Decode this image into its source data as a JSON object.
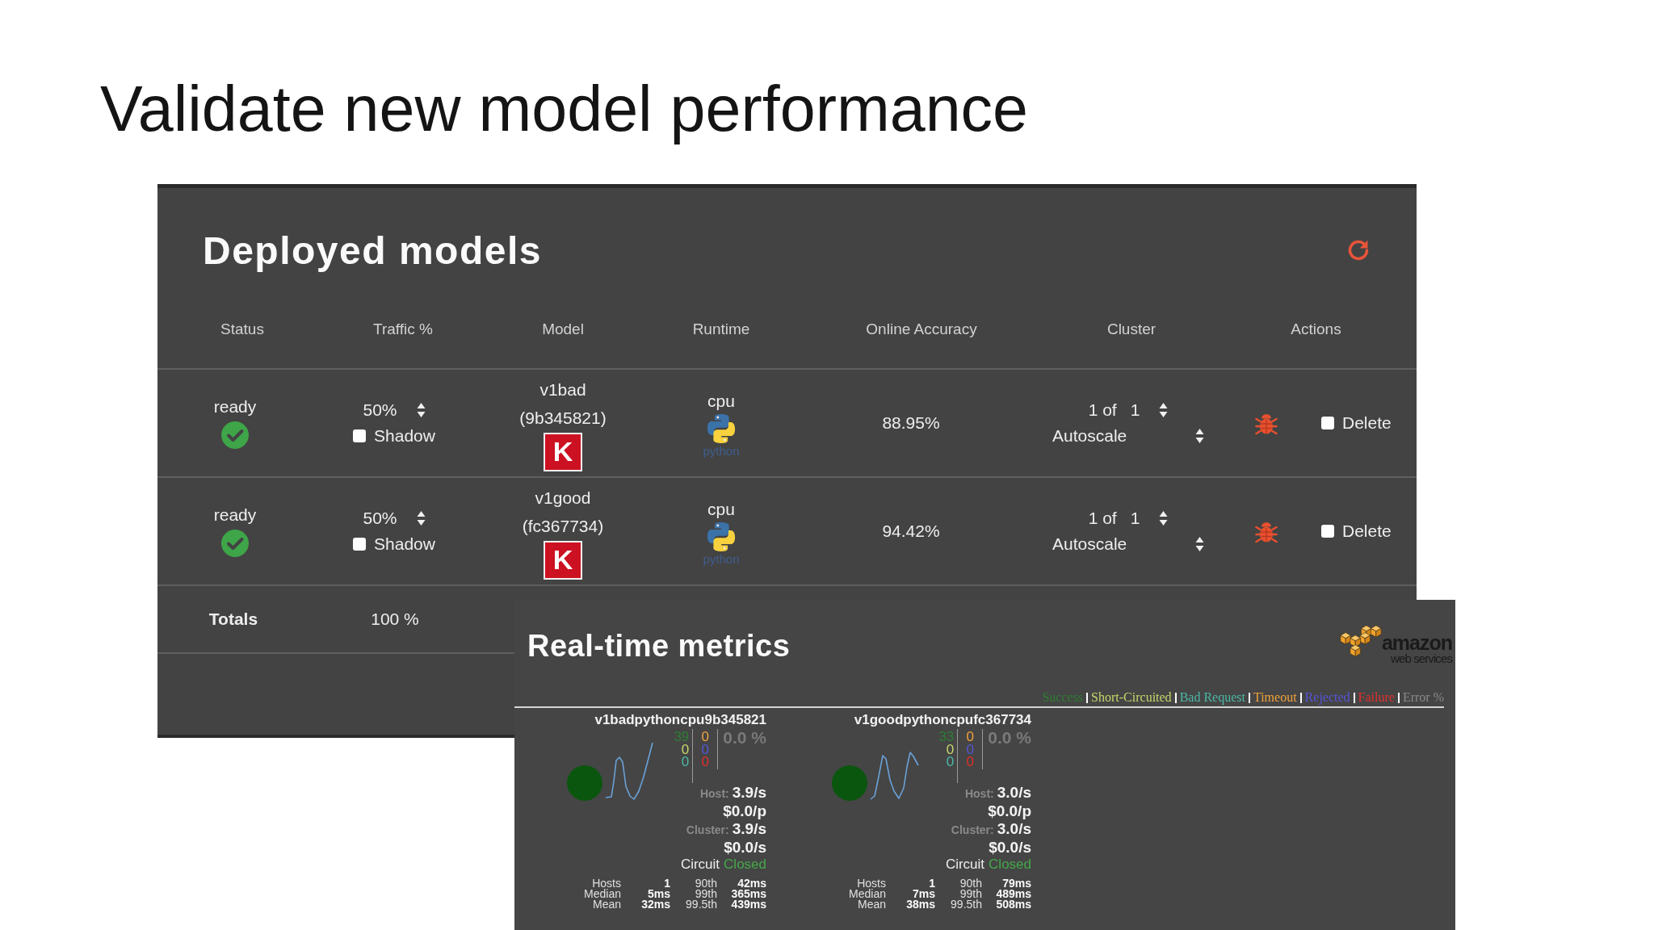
{
  "slide": {
    "title": "Validate new model performance"
  },
  "deployed_models": {
    "title": "Deployed models",
    "columns": [
      "Status",
      "Traffic %",
      "Model",
      "Runtime",
      "Online Accuracy",
      "Cluster",
      "Actions"
    ],
    "rows": [
      {
        "status": "ready",
        "traffic": "50%",
        "shadow": {
          "label": "Shadow",
          "checked": false
        },
        "model": {
          "name": "v1bad",
          "hash": "(9b345821)",
          "logo": "K"
        },
        "runtime": {
          "name": "cpu",
          "logo": "python"
        },
        "accuracy": "88.95%",
        "cluster": {
          "label": "1 of",
          "replicas": "1",
          "mode": "Autoscale"
        },
        "delete": {
          "label": "Delete",
          "checked": false
        }
      },
      {
        "status": "ready",
        "traffic": "50%",
        "shadow": {
          "label": "Shadow",
          "checked": false
        },
        "model": {
          "name": "v1good",
          "hash": "(fc367734)",
          "logo": "K"
        },
        "runtime": {
          "name": "cpu",
          "logo": "python"
        },
        "accuracy": "94.42%",
        "cluster": {
          "label": "1 of",
          "replicas": "1",
          "mode": "Autoscale"
        },
        "delete": {
          "label": "Delete",
          "checked": false
        }
      }
    ],
    "totals": {
      "label": "Totals",
      "traffic": "100 %"
    }
  },
  "realtime_metrics": {
    "title": "Real-time metrics",
    "logo": {
      "line_1": "amazon",
      "line_2": "web services"
    },
    "legend": [
      {
        "label": "Success",
        "color": "#2e7d32"
      },
      {
        "label": "Short-Circuited",
        "color": "#c6d66a"
      },
      {
        "label": "Bad Request",
        "color": "#4cb8a6"
      },
      {
        "label": "Timeout",
        "color": "#f0a23c"
      },
      {
        "label": "Rejected",
        "color": "#5555d8"
      },
      {
        "label": "Failure",
        "color": "#e0302e"
      },
      {
        "label": "Error %",
        "color": "#8a8a8a"
      }
    ],
    "cards": [
      {
        "name": "v1badpythoncpu9b345821",
        "counts": [
          [
            {
              "value": "39",
              "color": "#2e7d32"
            },
            {
              "value": "0",
              "color": "#c6d66a"
            },
            {
              "value": "0",
              "color": "#4cb8a6"
            }
          ],
          [
            {
              "value": "0",
              "color": "#f0a23c"
            },
            {
              "value": "0",
              "color": "#5555d8"
            },
            {
              "value": "0",
              "color": "#e0302e"
            }
          ]
        ],
        "error_rate": "0.0 %",
        "rates": [
          {
            "label": "Host:",
            "value": "3.9/s"
          },
          {
            "value": "$0.0/p"
          },
          {
            "label": "Cluster:",
            "value": "3.9/s"
          },
          {
            "value": "$0.0/s"
          }
        ],
        "circuit": {
          "label": "Circuit",
          "status": "Closed"
        },
        "stats": [
          {
            "label": "Hosts",
            "value": "1",
            "percentile": "90th",
            "latency": "42ms"
          },
          {
            "label": "Median",
            "value": "5ms",
            "percentile": "99th",
            "latency": "365ms"
          },
          {
            "label": "Mean",
            "value": "32ms",
            "percentile": "99.5th",
            "latency": "439ms"
          }
        ]
      },
      {
        "name": "v1goodpythoncpufc367734",
        "counts": [
          [
            {
              "value": "33",
              "color": "#2e7d32"
            },
            {
              "value": "0",
              "color": "#c6d66a"
            },
            {
              "value": "0",
              "color": "#4cb8a6"
            }
          ],
          [
            {
              "value": "0",
              "color": "#f0a23c"
            },
            {
              "value": "0",
              "color": "#5555d8"
            },
            {
              "value": "0",
              "color": "#e0302e"
            }
          ]
        ],
        "error_rate": "0.0 %",
        "rates": [
          {
            "label": "Host:",
            "value": "3.0/s"
          },
          {
            "value": "$0.0/p"
          },
          {
            "label": "Cluster:",
            "value": "3.0/s"
          },
          {
            "value": "$0.0/s"
          }
        ],
        "circuit": {
          "label": "Circuit",
          "status": "Closed"
        },
        "stats": [
          {
            "label": "Hosts",
            "value": "1",
            "percentile": "90th",
            "latency": "79ms"
          },
          {
            "label": "Median",
            "value": "7ms",
            "percentile": "99th",
            "latency": "489ms"
          },
          {
            "label": "Mean",
            "value": "38ms",
            "percentile": "99.5th",
            "latency": "508ms"
          }
        ]
      }
    ]
  }
}
